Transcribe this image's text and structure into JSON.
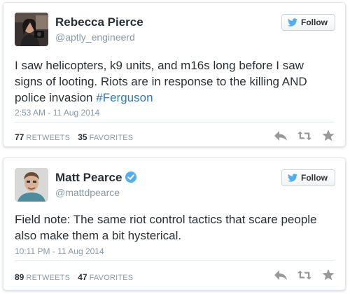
{
  "tweets": [
    {
      "name": "Rebecca Pierce",
      "handle": "@aptly_engineerd",
      "verified": false,
      "follow_label": "Follow",
      "text_main": "I saw helicopters, k9 units, and m16s long before I saw signs of looting. Riots are in response to the killing AND police invasion ",
      "hashtag": "#Ferguson",
      "timestamp": "2:53 AM - 11 Aug 2014",
      "retweets": "77",
      "retweets_label": "RETWEETS",
      "favorites": "35",
      "favorites_label": "FAVORITES"
    },
    {
      "name": "Matt Pearce",
      "handle": "@mattdpearce",
      "verified": true,
      "follow_label": "Follow",
      "text_main": "Field note: The same riot control tactics that scare people also make them a bit hysterical.",
      "hashtag": "",
      "timestamp": "10:11 PM - 11 Aug 2014",
      "retweets": "89",
      "retweets_label": "RETWEETS",
      "favorites": "47",
      "favorites_label": "FAVORITES"
    }
  ],
  "icons": {
    "follow": "twitter-bird-icon",
    "reply": "reply-icon",
    "retweet": "retweet-icon",
    "favorite": "star-icon",
    "verified": "verified-badge-icon"
  },
  "colors": {
    "link": "#2b7bb9",
    "muted": "#8899a6",
    "text": "#292f33",
    "twitter_blue": "#55acee",
    "action_gray": "#999999"
  }
}
